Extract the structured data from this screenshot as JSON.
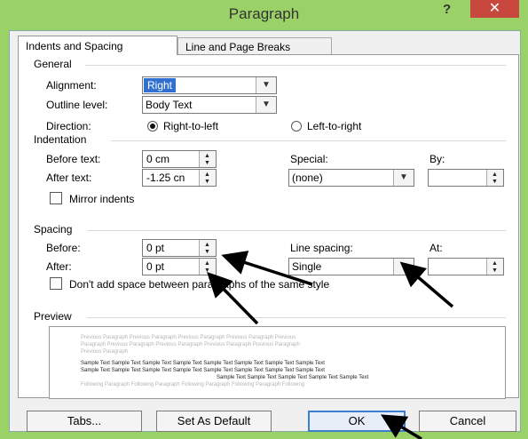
{
  "window": {
    "title": "Paragraph",
    "help_label": "?",
    "close_label": "✕"
  },
  "tabs": [
    {
      "label": "Indents and Spacing"
    },
    {
      "label": "Line and Page Breaks"
    }
  ],
  "general": {
    "heading": "General",
    "alignment_label": "Alignment:",
    "alignment_value": "Right",
    "outline_label": "Outline level:",
    "outline_value": "Body Text",
    "direction_label": "Direction:",
    "rtl_label": "Right-to-left",
    "ltr_label": "Left-to-right"
  },
  "indentation": {
    "heading": "Indentation",
    "before_label": "Before text:",
    "before_value": "0 cm",
    "after_label": "After text:",
    "after_value": "-1.25 cn",
    "special_label": "Special:",
    "special_value": "(none)",
    "by_label": "By:",
    "by_value": "",
    "mirror_label": "Mirror indents"
  },
  "spacing": {
    "heading": "Spacing",
    "before_label": "Before:",
    "before_value": "0 pt",
    "after_label": "After:",
    "after_value": "0 pt",
    "line_spacing_label": "Line spacing:",
    "line_spacing_value": "Single",
    "at_label": "At:",
    "at_value": "",
    "dont_add_label": "Don't add space between paragraphs of the same style"
  },
  "preview": {
    "heading": "Preview",
    "previous_lines": [
      "Previous Paragraph Previous Paragraph Previous Paragraph Previous Paragraph Previous",
      "Paragraph Previous Paragraph Previous Paragraph Previous Paragraph Previous Paragraph",
      "Previous Paragraph"
    ],
    "sample_lines": [
      "Sample Text Sample Text Sample Text Sample Text Sample Text Sample Text Sample Text Sample Text",
      "Sample Text Sample Text Sample Text Sample Text Sample Text Sample Text Sample Text Sample Text",
      "Sample Text Sample Text Sample Text Sample Text Sample Text"
    ],
    "following_lines": [
      "Following Paragraph Following Paragraph Following Paragraph Following Paragraph Following"
    ]
  },
  "buttons": {
    "tabs_label": "Tabs...",
    "default_label": "Set As Default",
    "ok_label": "OK",
    "cancel_label": "Cancel"
  },
  "icons": {
    "combo_arrow": "chevron-down-icon",
    "spin_up": "spin-up-icon",
    "spin_down": "spin-down-icon"
  },
  "colors": {
    "title_bar": "#9bd268",
    "close": "#c9483e",
    "selection": "#3070d0",
    "ok_border": "#3c7fd0",
    "arrow": "#000000"
  }
}
